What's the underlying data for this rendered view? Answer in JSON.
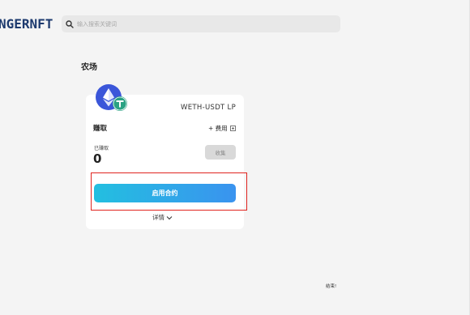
{
  "header": {
    "logo_text": "NGERNFT",
    "search": {
      "placeholder": "输入搜索关键词"
    }
  },
  "page": {
    "title": "农场"
  },
  "farm_card": {
    "tokens": [
      "eth-icon",
      "usdt-icon"
    ],
    "pair_name": "WETH-USDT LP",
    "earn_label": "赚取",
    "fee_label": "+ 费用",
    "earned_label": "已赚取",
    "earned_value": "0",
    "harvest_label": "收集",
    "enable_label": "启用合约",
    "details_label": "详情"
  },
  "footer": {
    "text": "结束!"
  },
  "colors": {
    "background": "#f4f4f4",
    "card": "#ffffff",
    "button_gradient_start": "#23bfe0",
    "button_gradient_end": "#3a93ef",
    "highlight": "#e0241f",
    "logo": "#1d3a6e"
  }
}
